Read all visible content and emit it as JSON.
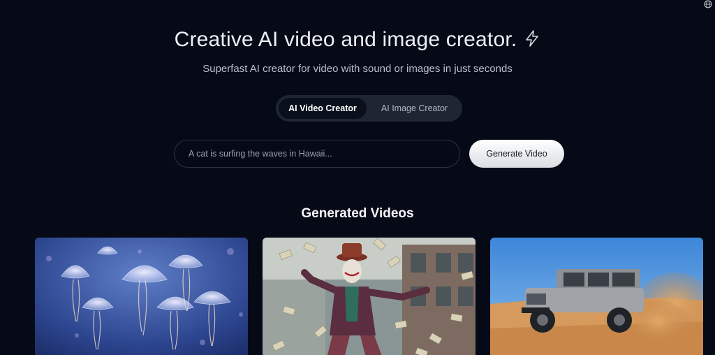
{
  "hero": {
    "title": "Creative AI video and image creator.",
    "subtitle": "Superfast AI creator for video with sound or images in just seconds"
  },
  "mode_toggle": {
    "options": [
      "AI Video Creator",
      "AI Image Creator"
    ],
    "selected": "AI Video Creator"
  },
  "prompt": {
    "placeholder": "A cat is surfing the waves in Hawaii...",
    "value": ""
  },
  "generate_button": {
    "label": "Generate Video"
  },
  "gallery": {
    "title": "Generated Videos",
    "items": [
      {
        "subject": "jellyfish"
      },
      {
        "subject": "dancing clown with flying money"
      },
      {
        "subject": "off-road jeep in desert"
      }
    ]
  },
  "colors": {
    "background": "#060a17",
    "toggle_bg": "#1f2633",
    "button_bg": "#ffffff"
  }
}
